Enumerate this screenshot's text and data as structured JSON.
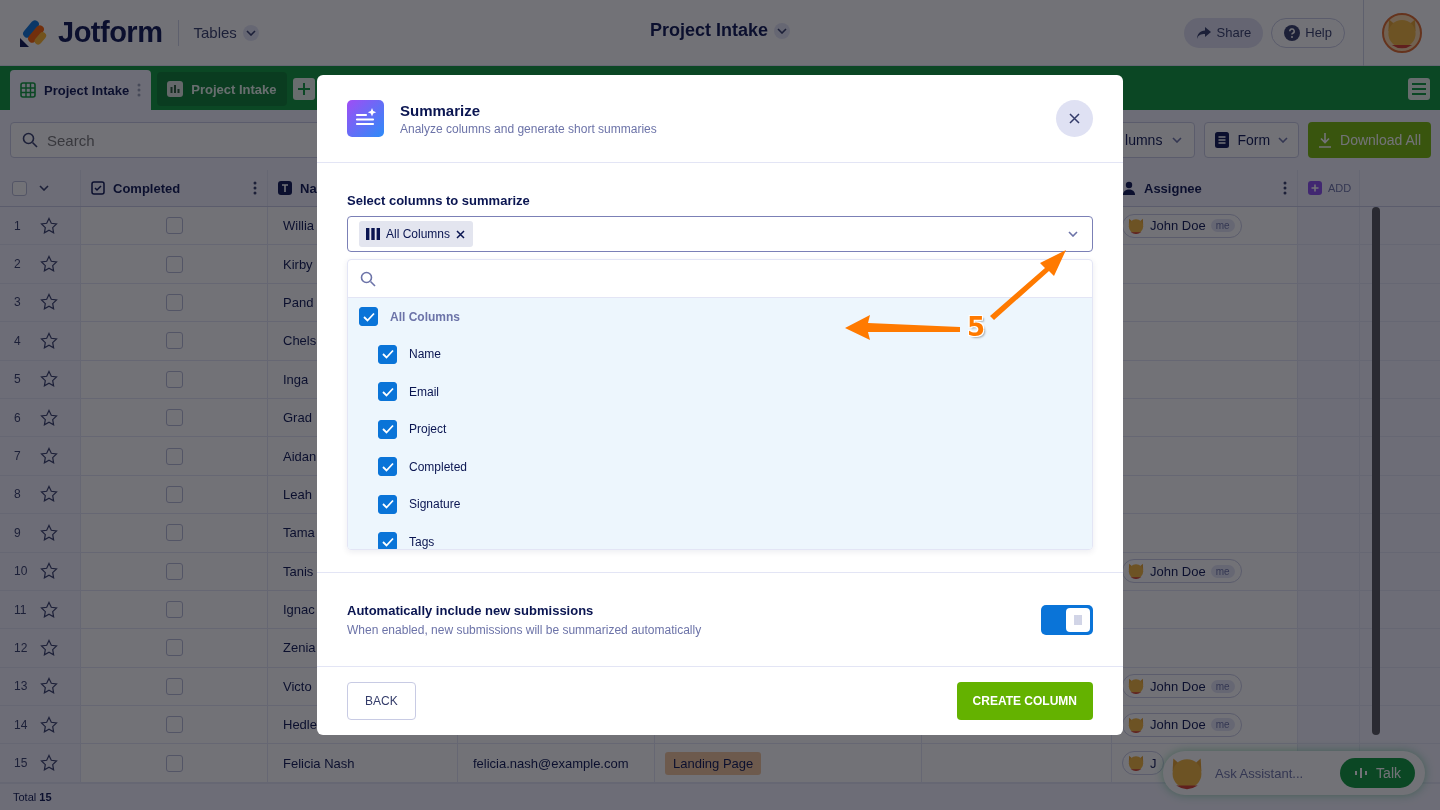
{
  "header": {
    "logo": "Jotform",
    "workspace": "Tables",
    "title": "Project Intake",
    "share": "Share",
    "help": "Help"
  },
  "tabs": [
    {
      "label": "Project Intake",
      "kind": "table",
      "selected": true
    },
    {
      "label": "Project Intake",
      "kind": "report",
      "selected": false
    }
  ],
  "toolbar": {
    "search_placeholder": "Search",
    "columns_button": "lumns",
    "form_button": "Form",
    "download_button": "Download All"
  },
  "table": {
    "header": {
      "select_all_checked": false,
      "completed": "Completed",
      "name": "Na",
      "assignee": "Assignee",
      "add": "ADD"
    },
    "rows": [
      {
        "number": "1",
        "starred": false,
        "completed": false,
        "name": "Willia",
        "assignee": {
          "name": "John Doe",
          "badge": "me"
        }
      },
      {
        "number": "2",
        "starred": false,
        "completed": false,
        "name": "Kirby"
      },
      {
        "number": "3",
        "starred": false,
        "completed": false,
        "name": "Pand"
      },
      {
        "number": "4",
        "starred": false,
        "completed": false,
        "name": "Chels"
      },
      {
        "number": "5",
        "starred": false,
        "completed": false,
        "name": "Inga"
      },
      {
        "number": "6",
        "starred": false,
        "completed": false,
        "name": "Grad"
      },
      {
        "number": "7",
        "starred": false,
        "completed": false,
        "name": "Aidan"
      },
      {
        "number": "8",
        "starred": false,
        "completed": false,
        "name": "Leah"
      },
      {
        "number": "9",
        "starred": false,
        "completed": false,
        "name": "Tama"
      },
      {
        "number": "10",
        "starred": false,
        "completed": false,
        "name": "Tanis",
        "assignee": {
          "name": "John Doe",
          "badge": "me"
        }
      },
      {
        "number": "11",
        "starred": false,
        "completed": false,
        "name": "Ignac"
      },
      {
        "number": "12",
        "starred": false,
        "completed": false,
        "name": "Zenia"
      },
      {
        "number": "13",
        "starred": false,
        "completed": false,
        "name": "Victo",
        "assignee": {
          "name": "John Doe",
          "badge": "me"
        }
      },
      {
        "number": "14",
        "starred": false,
        "completed": false,
        "name": "Hedle",
        "assignee": {
          "name": "John Doe",
          "badge": "me"
        }
      },
      {
        "number": "15",
        "starred": false,
        "completed": false,
        "name": "Felicia Nash",
        "email": "felicia.nash@example.com",
        "project": "Landing Page",
        "assignee": {
          "name": "J"
        }
      }
    ],
    "total_label": "Total",
    "total_count": "15"
  },
  "modal": {
    "title": "Summarize",
    "subtitle": "Analyze columns and generate short summaries",
    "field_label": "Select columns to summarize",
    "selected_chip": "All Columns",
    "options": [
      {
        "label": "All Columns",
        "checked": true,
        "children": [
          {
            "label": "Name",
            "checked": true
          },
          {
            "label": "Email",
            "checked": true
          },
          {
            "label": "Project",
            "checked": true
          },
          {
            "label": "Completed",
            "checked": true
          },
          {
            "label": "Signature",
            "checked": true
          },
          {
            "label": "Tags",
            "checked": true
          }
        ]
      }
    ],
    "auto_include": {
      "title": "Automatically include new submissions",
      "description": "When enabled, new submissions will be summarized automatically",
      "on": true
    },
    "buttons": {
      "back": "BACK",
      "create": "CREATE COLUMN"
    }
  },
  "annotation": {
    "label": "5"
  },
  "assistant": {
    "placeholder": "Ask Assistant...",
    "talk": "Talk"
  }
}
